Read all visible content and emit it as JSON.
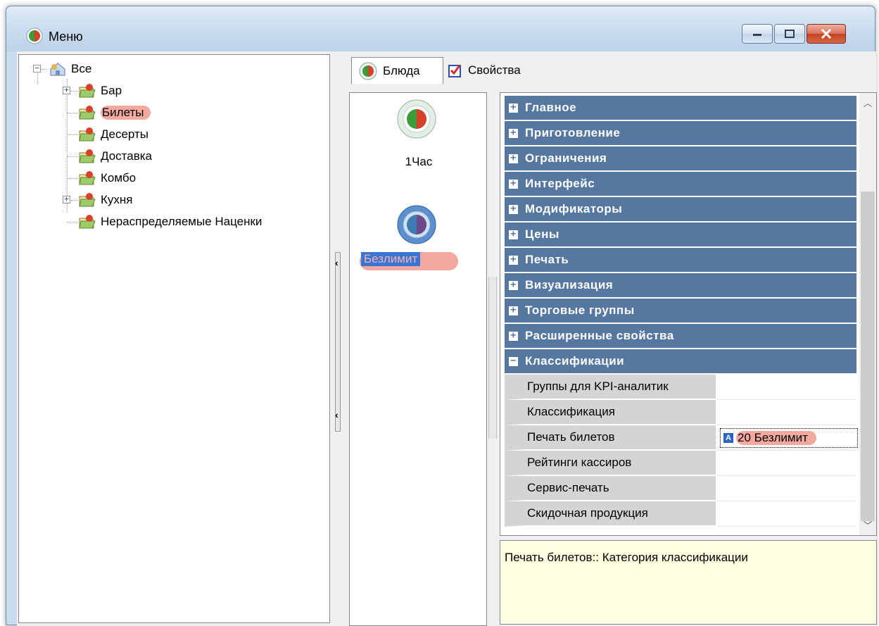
{
  "window": {
    "title": "Меню"
  },
  "tree": {
    "root": "Все",
    "items": [
      {
        "label": "Бар",
        "expandable": true,
        "highlighted": false
      },
      {
        "label": "Билеты",
        "expandable": false,
        "highlighted": true
      },
      {
        "label": "Десерты",
        "expandable": false,
        "highlighted": false
      },
      {
        "label": "Доставка",
        "expandable": false,
        "highlighted": false
      },
      {
        "label": "Комбо",
        "expandable": false,
        "highlighted": false
      },
      {
        "label": "Кухня",
        "expandable": true,
        "highlighted": false
      },
      {
        "label": "Нераспределяемые Наценки",
        "expandable": false,
        "highlighted": false
      }
    ]
  },
  "tabs": {
    "dishes": "Блюда",
    "properties": "Свойства"
  },
  "dishes": [
    {
      "label": "1Час",
      "selected": false
    },
    {
      "label": "Безлимит",
      "selected": true
    }
  ],
  "grid": {
    "categories": [
      "Главное",
      "Приготовление",
      "Ограничения",
      "Интерфейс",
      "Модификаторы",
      "Цены",
      "Печать",
      "Визуализация",
      "Торговые группы",
      "Расширенные свойства"
    ],
    "expanded_category": "Классификации",
    "properties": [
      {
        "name": "Группы для KPI-аналитик",
        "value": ""
      },
      {
        "name": "Классификация",
        "value": ""
      },
      {
        "name": "Печать билетов",
        "value": "20 Безлимит"
      },
      {
        "name": "Рейтинги кассиров",
        "value": ""
      },
      {
        "name": "Сервис-печать",
        "value": ""
      },
      {
        "name": "Скидочная продукция",
        "value": ""
      }
    ]
  },
  "description": "Печать билетов:: Категория классификации",
  "colors": {
    "category_bg": "#5577a0",
    "highlight": "#f3a99e",
    "selection": "#3875d7",
    "description_bg": "#ffffe1"
  }
}
